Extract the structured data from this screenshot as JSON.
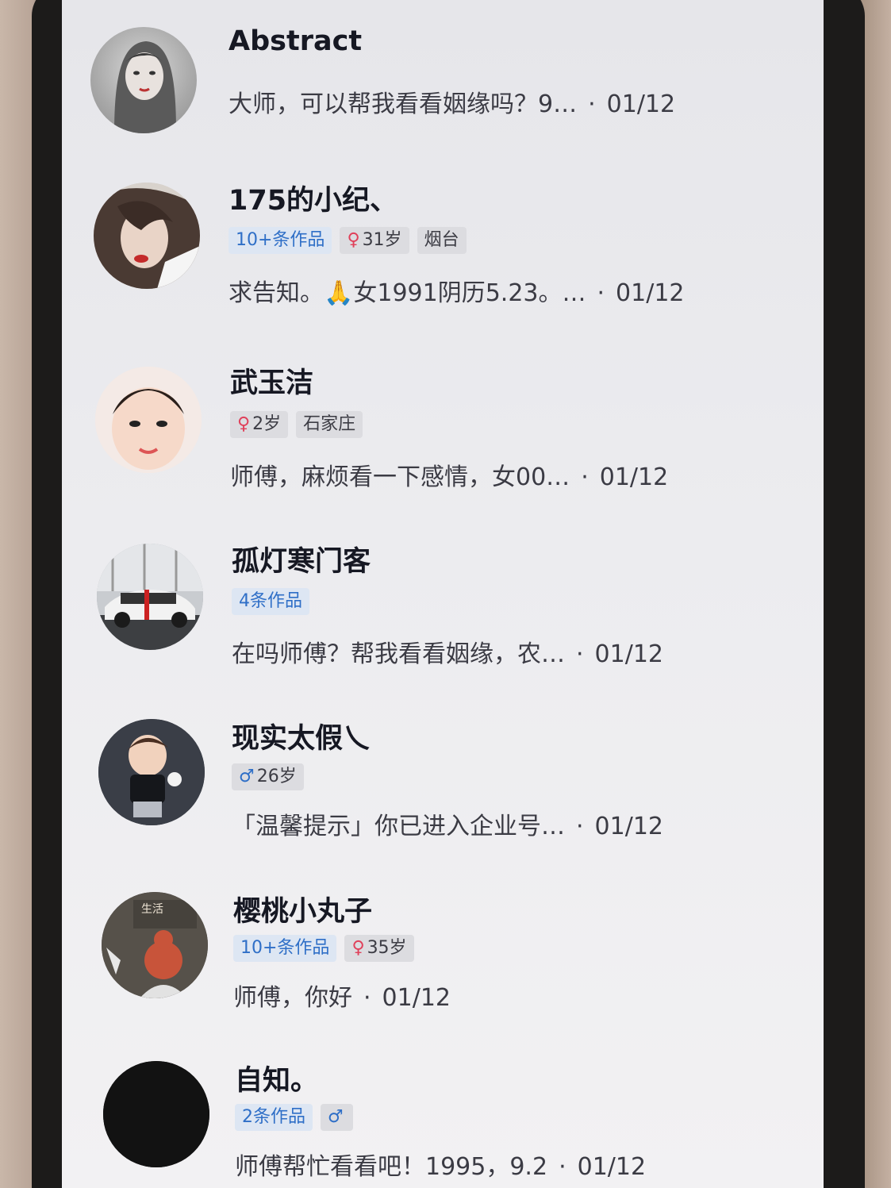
{
  "conversations": [
    {
      "name": "Abstract",
      "tags": [],
      "message": "大师，可以帮我看看姻缘吗？9…",
      "date": "01/12",
      "avatar": "woman-illustration-avatar"
    },
    {
      "name": "175的小纪、",
      "tags": [
        {
          "type": "works",
          "text": "10+条作品"
        },
        {
          "type": "info",
          "symbol": "♀",
          "text": "31岁"
        },
        {
          "type": "info",
          "text": "烟台"
        }
      ],
      "message": "求告知。🙏女1991阴历5.23。…",
      "date": "01/12",
      "avatar": "woman-photo-avatar"
    },
    {
      "name": "武玉洁",
      "tags": [
        {
          "type": "info",
          "symbol": "♀",
          "text": "2岁"
        },
        {
          "type": "info",
          "text": "石家庄"
        }
      ],
      "message": "师傅，麻烦看一下感情，女00…",
      "date": "01/12",
      "avatar": "child-photo-avatar"
    },
    {
      "name": "孤灯寒门客",
      "tags": [
        {
          "type": "works",
          "text": "4条作品"
        }
      ],
      "message": "在吗师傅？帮我看看姻缘，农…",
      "date": "01/12",
      "avatar": "car-photo-avatar"
    },
    {
      "name": "现实太假乀",
      "tags": [
        {
          "type": "info",
          "symbol": "♂",
          "text": "26岁"
        }
      ],
      "message": "「温馨提示」你已进入企业号…",
      "date": "01/12",
      "avatar": "cartoon-boy-avatar"
    },
    {
      "name": "樱桃小丸子",
      "tags": [
        {
          "type": "works",
          "text": "10+条作品"
        },
        {
          "type": "info",
          "symbol": "♀",
          "text": "35岁"
        }
      ],
      "message": "师傅，你好",
      "date": "01/12",
      "avatar": "cartoon-girl-avatar"
    },
    {
      "name": "自知。",
      "tags": [
        {
          "type": "works",
          "text": "2条作品"
        },
        {
          "type": "info",
          "symbol": "♂",
          "text": ""
        }
      ],
      "message": "师傅帮忙看看吧！1995，9.2",
      "date": "01/12",
      "avatar": "black-avatar"
    }
  ]
}
